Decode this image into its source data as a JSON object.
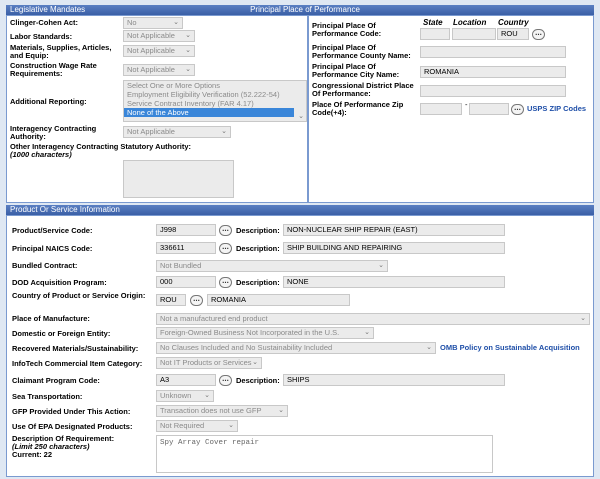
{
  "legislative": {
    "section_title": "Legislative Mandates",
    "clinger_label": "Clinger-Cohen Act:",
    "clinger_value": "No",
    "labor_label": "Labor Standards:",
    "labor_value": "Not Applicable",
    "materials_label": "Materials, Supplies, Articles, and Equip:",
    "materials_value": "Not Applicable",
    "construction_label": "Construction Wage Rate Requirements:",
    "construction_value": "Not Applicable",
    "additional_label": "Additional Reporting:",
    "additional_options": [
      "Select One or More Options",
      "Employment Eligibility Verification (52.222-54)",
      "Service Contract Inventory (FAR 4.17)",
      "None of the Above"
    ],
    "interagency_label": "Interagency Contracting Authority:",
    "interagency_value": "Not Applicable",
    "other_label": "Other Interagency Contracting Statutory Authority:",
    "other_hint": "(1000 characters)"
  },
  "place": {
    "section_title": "Principal Place of Performance",
    "code_label": "Principal Place Of Performance Code:",
    "state_header": "State",
    "location_header": "Location",
    "country_header": "Country",
    "country_value": "ROU",
    "county_label": "Principal Place Of Performance County Name:",
    "city_label": "Principal Place Of Performance City Name:",
    "city_value": "ROMANIA",
    "district_label": "Congressional District Place Of Performance:",
    "zip_label": "Place Of Performance Zip Code(+4):",
    "zip_dash": "-",
    "usps_link": "USPS ZIP Codes"
  },
  "product": {
    "section_title": "Product Or Service Information",
    "psc_label": "Product/Service Code:",
    "psc_value": "J998",
    "psc_desc_label": "Description:",
    "psc_desc": "NON-NUCLEAR SHIP REPAIR (EAST)",
    "naics_label": "Principal NAICS Code:",
    "naics_value": "336611",
    "naics_desc_label": "Description:",
    "naics_desc": "SHIP BUILDING AND REPAIRING",
    "bundled_label": "Bundled Contract:",
    "bundled_value": "Not Bundled",
    "dod_label": "DOD Acquisition Program:",
    "dod_value": "000",
    "dod_desc_label": "Description:",
    "dod_desc": "NONE",
    "origin_label": "Country of Product or Service Origin:",
    "origin_code": "ROU",
    "origin_name": "ROMANIA",
    "manufacture_label": "Place of Manufacture:",
    "manufacture_value": "Not a manufactured end product",
    "domestic_label": "Domestic or Foreign Entity:",
    "domestic_value": "Foreign-Owned Business Not Incorporated in the U.S.",
    "recovered_label": "Recovered Materials/Sustainability:",
    "recovered_value": "No Clauses Included and No Sustainability Included",
    "omb_link": "OMB Policy on Sustainable Acquisition",
    "infotech_label": "InfoTech Commercial Item Category:",
    "infotech_value": "Not IT Products or Services",
    "claimant_label": "Claimant Program Code:",
    "claimant_value": "A3",
    "claimant_desc_label": "Description:",
    "claimant_desc": "SHIPS",
    "sea_label": "Sea Transportation:",
    "sea_value": "Unknown",
    "gfp_label": "GFP Provided Under This Action:",
    "gfp_value": "Transaction does not use GFP",
    "epa_label": "Use Of EPA Designated Products:",
    "epa_value": "Not Required",
    "desc_req_label": "Description Of Requirement:",
    "desc_req_limit": "(Limit 250 characters)",
    "desc_req_current": "Current: 22",
    "desc_req_value": "Spy Array Cover repair"
  },
  "icons": {
    "lookup": "more-dots-icon",
    "dropdown": "chevron-down-icon"
  }
}
